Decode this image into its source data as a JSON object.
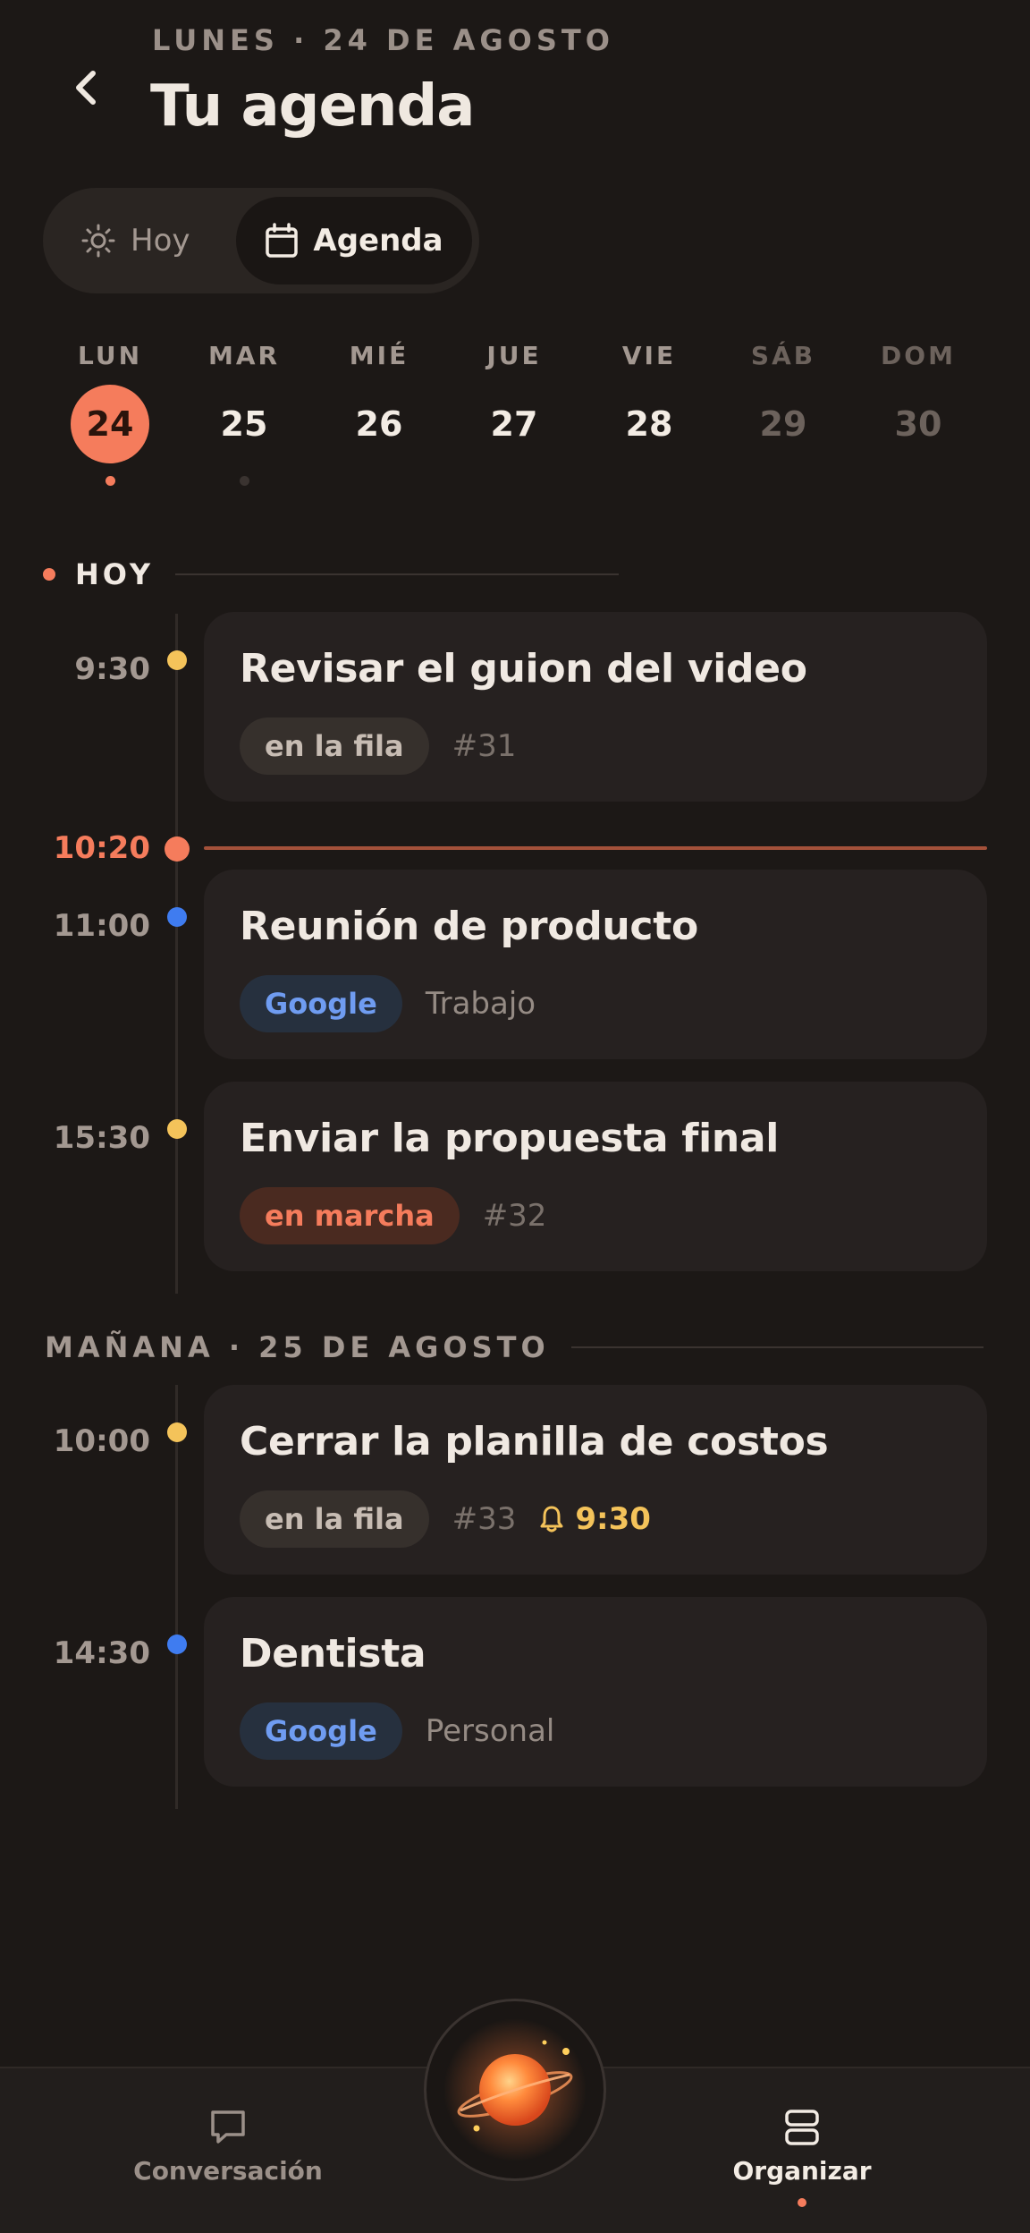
{
  "header": {
    "eyebrow": "LUNES · 24 DE AGOSTO",
    "title": "Tu agenda"
  },
  "segmented": {
    "hoy_label": "Hoy",
    "agenda_label": "Agenda",
    "selected": "Agenda"
  },
  "week": [
    {
      "name": "LUN",
      "num": "24",
      "selected": true,
      "dot": "#f57c5c"
    },
    {
      "name": "MAR",
      "num": "25",
      "dot": "#3a3330"
    },
    {
      "name": "MIÉ",
      "num": "26"
    },
    {
      "name": "JUE",
      "num": "27"
    },
    {
      "name": "VIE",
      "num": "28"
    },
    {
      "name": "SÁB",
      "num": "29",
      "weekend": true
    },
    {
      "name": "DOM",
      "num": "30",
      "weekend": true
    }
  ],
  "sections": {
    "today": "HOY",
    "tomorrow": "MAÑANA · 25 DE AGOSTO"
  },
  "now": {
    "time": "10:20"
  },
  "events": [
    {
      "time": "9:30",
      "title": "Revisar el guion del video",
      "pill": "en la fila",
      "pill_kind": "fila",
      "number": "#31",
      "dot_color": "#f4c35a"
    },
    {
      "time": "11:00",
      "title": "Reunión de producto",
      "pill": "Google",
      "pill_kind": "google",
      "calendar": "Trabajo",
      "dot_color": "#3f7cf0"
    },
    {
      "time": "15:30",
      "title": "Enviar la propuesta final",
      "pill": "en marcha",
      "pill_kind": "marcha",
      "number": "#32",
      "dot_color": "#f4c35a"
    },
    {
      "time": "10:00",
      "title": "Cerrar la planilla de costos",
      "pill": "en la fila",
      "pill_kind": "fila",
      "number": "#33",
      "alarm": "9:30",
      "dot_color": "#f4c35a"
    },
    {
      "time": "14:30",
      "title": "Dentista",
      "pill": "Google",
      "pill_kind": "google",
      "calendar": "Personal",
      "dot_color": "#3f7cf0"
    }
  ],
  "bottom_nav": {
    "conversacion": "Conversación",
    "organizar": "Organizar",
    "active": "Organizar"
  },
  "colors": {
    "accent": "#f57c5c",
    "yellow": "#f4c35a",
    "blue": "#3f7cf0",
    "background": "#1c1816"
  }
}
